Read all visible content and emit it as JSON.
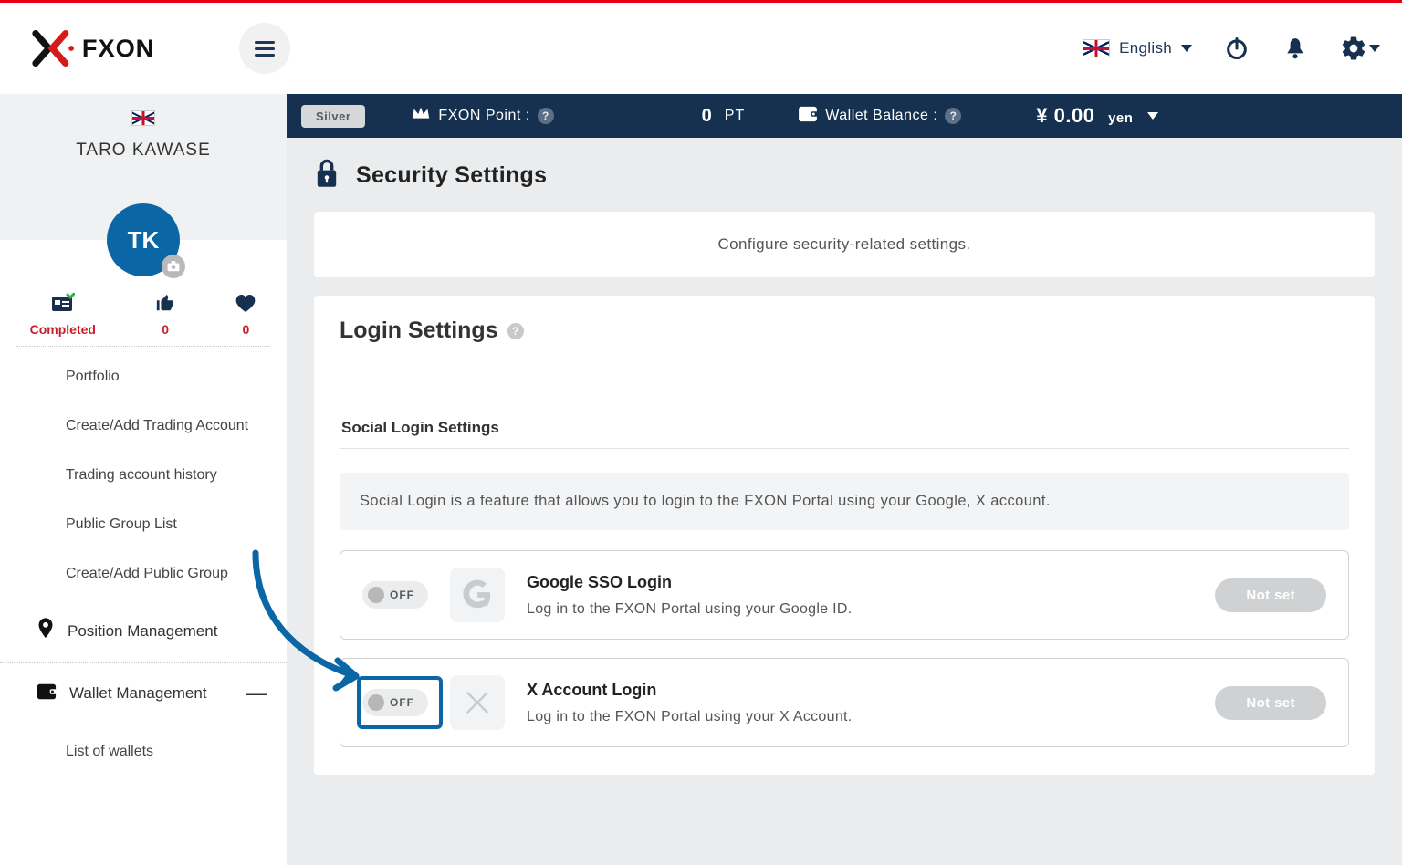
{
  "header": {
    "language_label": "English"
  },
  "sidebar": {
    "username": "TARO KAWASE",
    "avatar_initials": "TK",
    "stats": {
      "completed_label": "Completed",
      "thumbs_count": "0",
      "heart_count": "0"
    },
    "menu": {
      "portfolio": "Portfolio",
      "create_account": "Create/Add Trading Account",
      "trading_history": "Trading account history",
      "public_group_list": "Public Group List",
      "create_public_group": "Create/Add Public Group",
      "position_mgmt": "Position Management",
      "wallet_mgmt": "Wallet Management",
      "list_of_wallets": "List of wallets"
    }
  },
  "statusbar": {
    "tier": "Silver",
    "points_label": "FXON Point :",
    "points_value": "0",
    "points_unit": "PT",
    "wallet_label": "Wallet Balance :",
    "wallet_value": "¥ 0.00",
    "wallet_unit": "yen"
  },
  "page": {
    "title": "Security Settings",
    "intro": "Configure security-related settings.",
    "login_settings_title": "Login Settings",
    "social_subhead": "Social Login Settings",
    "social_info": "Social Login is a feature that allows you to login to the FXON Portal using your Google, X account.",
    "toggle_off_label": "OFF",
    "not_set_label": "Not set",
    "google": {
      "title": "Google SSO Login",
      "desc": "Log in to the FXON Portal using your Google ID."
    },
    "x": {
      "title": "X Account Login",
      "desc": "Log in to the FXON Portal using your X Account."
    }
  }
}
